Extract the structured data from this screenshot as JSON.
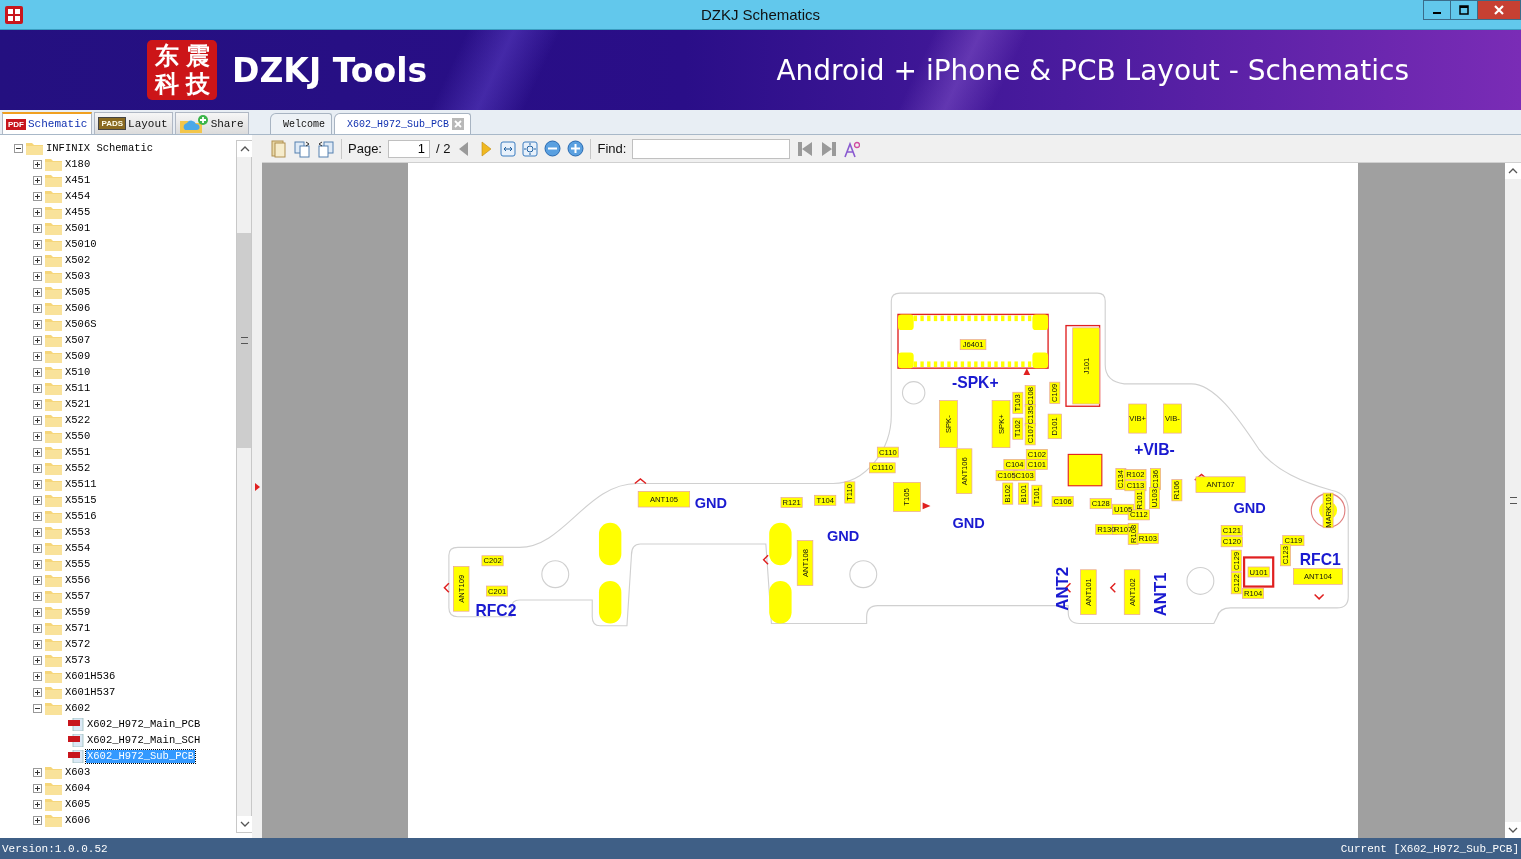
{
  "window": {
    "title": "DZKJ Schematics"
  },
  "banner": {
    "logo_chars": [
      "东",
      "震",
      "科",
      "技"
    ],
    "brand": "DZKJ Tools",
    "tagline": "Android + iPhone & PCB Layout - Schematics"
  },
  "panel_tabs": [
    {
      "label": "Schematic",
      "badge": "PDF",
      "kind": "pdf",
      "selected": true
    },
    {
      "label": "Layout",
      "badge": "PADS",
      "kind": "pads",
      "selected": false
    },
    {
      "label": "Share",
      "kind": "cloud",
      "selected": false
    }
  ],
  "doc_tabs": [
    {
      "label": "Welcome",
      "selected": false,
      "closable": false
    },
    {
      "label": "X602_H972_Sub_PCB",
      "selected": true,
      "closable": true
    }
  ],
  "toolbar": {
    "page_label": "Page:",
    "page_value": "1",
    "page_total": "/ 2",
    "prev_disabled": true,
    "next_disabled": false,
    "find_label": "Find:",
    "find_prev_disabled": true,
    "find_next_disabled": true
  },
  "tree": [
    {
      "label": "INFINIX Schematic",
      "kind": "folder",
      "expanded": true,
      "selected": false,
      "children": [
        {
          "label": "X180",
          "kind": "folder",
          "expanded": false,
          "selected": false
        },
        {
          "label": "X451",
          "kind": "folder",
          "expanded": false,
          "selected": false
        },
        {
          "label": "X454",
          "kind": "folder",
          "expanded": false,
          "selected": false
        },
        {
          "label": "X455",
          "kind": "folder",
          "expanded": false,
          "selected": false
        },
        {
          "label": "X501",
          "kind": "folder",
          "expanded": false,
          "selected": false
        },
        {
          "label": "X5010",
          "kind": "folder",
          "expanded": false,
          "selected": false
        },
        {
          "label": "X502",
          "kind": "folder",
          "expanded": false,
          "selected": false
        },
        {
          "label": "X503",
          "kind": "folder",
          "expanded": false,
          "selected": false
        },
        {
          "label": "X505",
          "kind": "folder",
          "expanded": false,
          "selected": false
        },
        {
          "label": "X506",
          "kind": "folder",
          "expanded": false,
          "selected": false
        },
        {
          "label": "X506S",
          "kind": "folder",
          "expanded": false,
          "selected": false
        },
        {
          "label": "X507",
          "kind": "folder",
          "expanded": false,
          "selected": false
        },
        {
          "label": "X509",
          "kind": "folder",
          "expanded": false,
          "selected": false
        },
        {
          "label": "X510",
          "kind": "folder",
          "expanded": false,
          "selected": false
        },
        {
          "label": "X511",
          "kind": "folder",
          "expanded": false,
          "selected": false
        },
        {
          "label": "X521",
          "kind": "folder",
          "expanded": false,
          "selected": false
        },
        {
          "label": "X522",
          "kind": "folder",
          "expanded": false,
          "selected": false
        },
        {
          "label": "X550",
          "kind": "folder",
          "expanded": false,
          "selected": false
        },
        {
          "label": "X551",
          "kind": "folder",
          "expanded": false,
          "selected": false
        },
        {
          "label": "X552",
          "kind": "folder",
          "expanded": false,
          "selected": false
        },
        {
          "label": "X5511",
          "kind": "folder",
          "expanded": false,
          "selected": false
        },
        {
          "label": "X5515",
          "kind": "folder",
          "expanded": false,
          "selected": false
        },
        {
          "label": "X5516",
          "kind": "folder",
          "expanded": false,
          "selected": false
        },
        {
          "label": "X553",
          "kind": "folder",
          "expanded": false,
          "selected": false
        },
        {
          "label": "X554",
          "kind": "folder",
          "expanded": false,
          "selected": false
        },
        {
          "label": "X555",
          "kind": "folder",
          "expanded": false,
          "selected": false
        },
        {
          "label": "X556",
          "kind": "folder",
          "expanded": false,
          "selected": false
        },
        {
          "label": "X557",
          "kind": "folder",
          "expanded": false,
          "selected": false
        },
        {
          "label": "X559",
          "kind": "folder",
          "expanded": false,
          "selected": false
        },
        {
          "label": "X571",
          "kind": "folder",
          "expanded": false,
          "selected": false
        },
        {
          "label": "X572",
          "kind": "folder",
          "expanded": false,
          "selected": false
        },
        {
          "label": "X573",
          "kind": "folder",
          "expanded": false,
          "selected": false
        },
        {
          "label": "X601H536",
          "kind": "folder",
          "expanded": false,
          "selected": false
        },
        {
          "label": "X601H537",
          "kind": "folder",
          "expanded": false,
          "selected": false
        },
        {
          "label": "X602",
          "kind": "folder",
          "expanded": true,
          "selected": false,
          "children": [
            {
              "label": "X602_H972_Main_PCB",
              "kind": "pdf",
              "selected": false
            },
            {
              "label": "X602_H972_Main_SCH",
              "kind": "pdf",
              "selected": false
            },
            {
              "label": "X602_H972_Sub_PCB",
              "kind": "pdf",
              "selected": true
            }
          ]
        },
        {
          "label": "X603",
          "kind": "folder",
          "expanded": false,
          "selected": false
        },
        {
          "label": "X604",
          "kind": "folder",
          "expanded": false,
          "selected": false
        },
        {
          "label": "X605",
          "kind": "folder",
          "expanded": false,
          "selected": false
        },
        {
          "label": "X606",
          "kind": "folder",
          "expanded": false,
          "selected": false
        }
      ]
    }
  ],
  "pcb": {
    "net_labels": [
      "-SPK+",
      "+VIB-",
      "GND",
      "GND",
      "GND",
      "GND",
      "RFC1",
      "ANT2",
      "ANT1",
      "RFC2"
    ],
    "component_labels": [
      "J6401",
      "J101",
      "C109",
      "C108",
      "T103",
      "VIB+",
      "VIB-",
      "C135",
      "SPK-",
      "SPK+",
      "D101",
      "T102",
      "C107",
      "C110",
      "C102",
      "C104",
      "C101",
      "C1110",
      "ANT106",
      "C105",
      "C103",
      "C134",
      "R102",
      "C136",
      "C113",
      "ANT107",
      "T105",
      "T110",
      "ANT105",
      "R121",
      "T104",
      "B102",
      "B101",
      "T101",
      "C106",
      "R106",
      "R101",
      "U103",
      "C128",
      "U105",
      "MARK101",
      "C112",
      "C202",
      "R130",
      "R107",
      "R108",
      "C121",
      "R103",
      "C120",
      "C119",
      "C123",
      "ANT108",
      "C129",
      "U101",
      "ANT109",
      "ANT104",
      "ANT101",
      "ANT102",
      "C122",
      "C201",
      "R104"
    ]
  },
  "status_bar": {
    "version": "Version:1.0.0.52",
    "current": "Current [X602_H972_Sub_PCB]"
  }
}
